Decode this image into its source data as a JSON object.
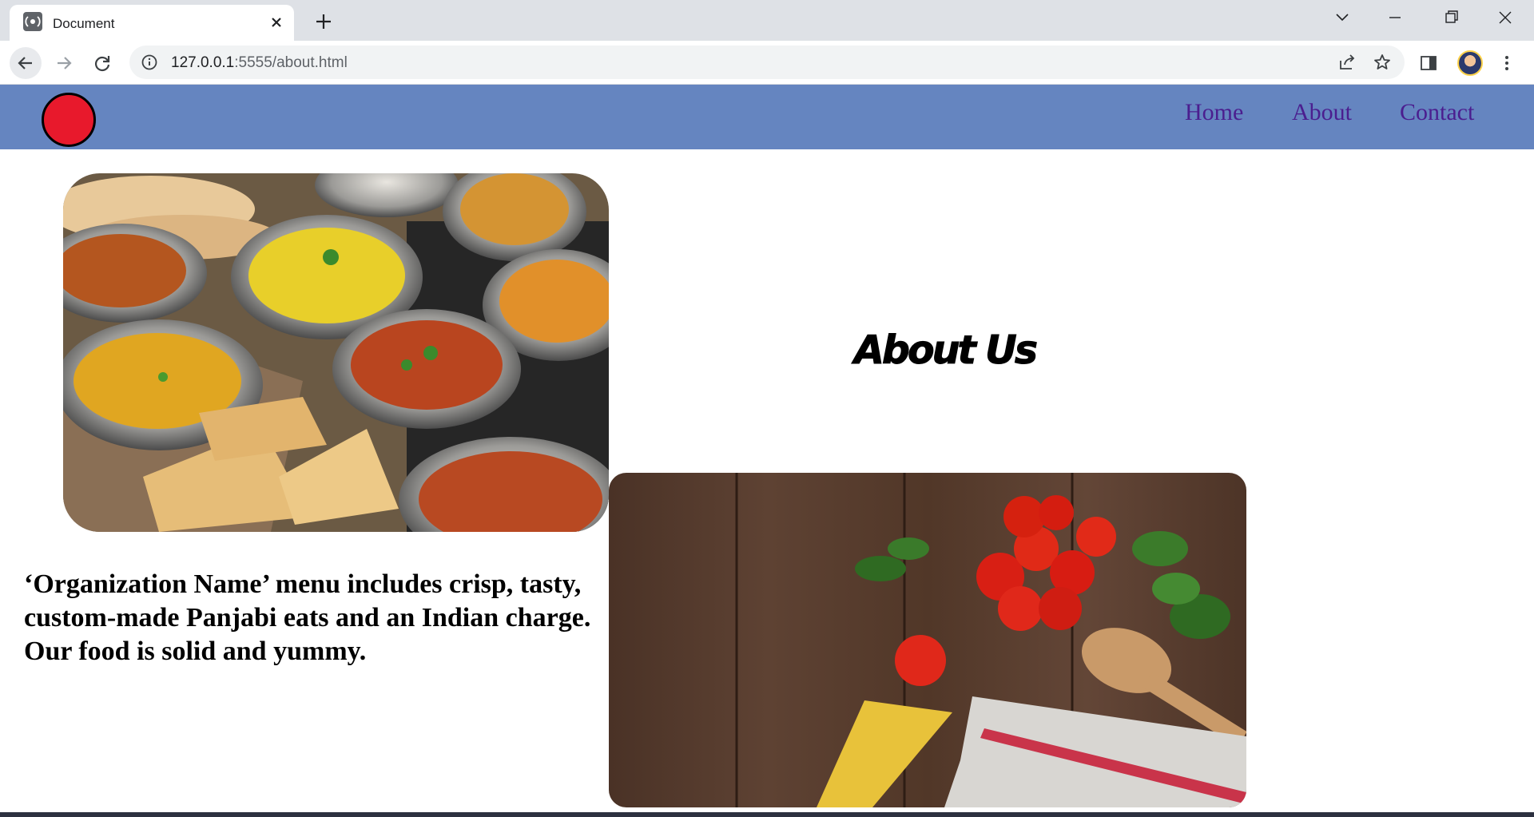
{
  "browser": {
    "tab_title": "Document",
    "url_host": "127.0.0.1",
    "url_path": ":5555/about.html",
    "icons": [
      "tab-favicon-icon",
      "close-icon",
      "plus-icon",
      "chevron-down-icon",
      "minimize-icon",
      "restore-icon",
      "window-close-icon",
      "back-arrow-icon",
      "forward-arrow-icon",
      "reload-icon",
      "info-icon",
      "share-icon",
      "star-icon",
      "side-panel-icon",
      "kebab-menu-icon"
    ]
  },
  "site": {
    "header_color": "#6585c0",
    "logo_color": "#e8192c",
    "nav": {
      "home": "Home",
      "about": "About",
      "contact": "Contact"
    },
    "title": "About Us",
    "description": "‘Organization Name’ menu includes crisp, tasty, custom-made Panjabi eats and an Indian charge. Our food is solid and yummy."
  }
}
